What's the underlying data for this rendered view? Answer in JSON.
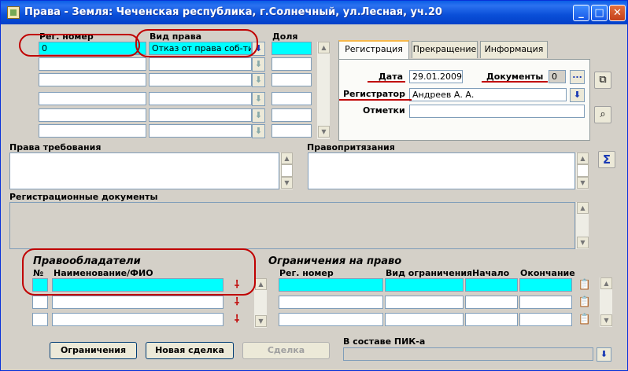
{
  "window": {
    "title": "Права - Земля: Чеченская республика, г.Солнечный, ул.Лесная, уч.20",
    "controls": {
      "minimize": "_",
      "maximize": "□",
      "close": "✕"
    }
  },
  "rights_grid": {
    "headers": {
      "reg_number": "Рег. номер",
      "right_type": "Вид права",
      "share": "Доля"
    },
    "rows": [
      {
        "reg_number": "0",
        "right_type": "Отказ от права соб-ти",
        "share": ""
      },
      {
        "reg_number": "",
        "right_type": "",
        "share": ""
      },
      {
        "reg_number": "",
        "right_type": "",
        "share": ""
      },
      {
        "reg_number": "",
        "right_type": "",
        "share": ""
      },
      {
        "reg_number": "",
        "right_type": "",
        "share": ""
      },
      {
        "reg_number": "",
        "right_type": "",
        "share": ""
      }
    ]
  },
  "tabs": [
    {
      "label": "Регистрация",
      "active": true
    },
    {
      "label": "Прекращение",
      "active": false
    },
    {
      "label": "Информация",
      "active": false
    }
  ],
  "registration": {
    "date_label": "Дата",
    "date_value": "29.01.2009",
    "documents_label": "Документы",
    "documents_count": "0",
    "documents_button": "...",
    "registrar_label": "Регистратор",
    "registrar_value": "Андреев А. А.",
    "notes_label": "Отметки",
    "notes_value": ""
  },
  "claims": {
    "label": "Права требования"
  },
  "pretensions": {
    "label": "Правопритязания"
  },
  "reg_docs": {
    "label": "Регистрационные документы"
  },
  "holders": {
    "title": "Правообладатели",
    "col_no": "№",
    "col_name": "Наименование/ФИО",
    "rows": [
      {
        "no": "",
        "name": ""
      },
      {
        "no": "",
        "name": ""
      },
      {
        "no": "",
        "name": ""
      }
    ]
  },
  "restrictions": {
    "title": "Ограничения на право",
    "headers": {
      "reg_number": "Рег. номер",
      "type": "Вид ограничения",
      "start": "Начало",
      "end": "Окончание"
    },
    "rows": [
      {
        "reg_number": "",
        "type": "",
        "start": "",
        "end": ""
      },
      {
        "reg_number": "",
        "type": "",
        "start": "",
        "end": ""
      },
      {
        "reg_number": "",
        "type": "",
        "start": "",
        "end": ""
      }
    ]
  },
  "buttons": {
    "restrictions": "Ограничения",
    "new_deal": "Новая сделка",
    "deal": "Сделка"
  },
  "pik": {
    "label": "В составе ПИК-а",
    "value": ""
  },
  "colors": {
    "highlight": "#00ffff",
    "annotation": "#c00000",
    "face": "#d4d0c8"
  }
}
